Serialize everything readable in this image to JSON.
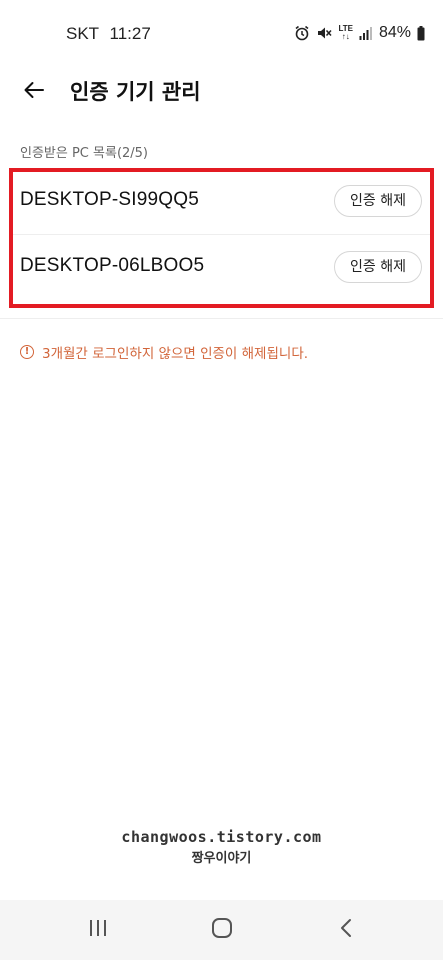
{
  "status_bar": {
    "carrier": "SKT",
    "time": "11:27",
    "battery": "84%",
    "lte_top": "LTE",
    "lte_bottom": "↑↓"
  },
  "header": {
    "title": "인증 기기 관리"
  },
  "section": {
    "label": "인증받은 PC 목록(2/5)"
  },
  "devices": [
    {
      "name": "DESKTOP-SI99QQ5",
      "action_label": "인증 해제"
    },
    {
      "name": "DESKTOP-06LBOO5",
      "action_label": "인증 해제"
    }
  ],
  "notice": {
    "icon_glyph": "!",
    "text": "3개월간 로그인하지 않으면 인증이 해제됩니다."
  },
  "watermark": {
    "url": "changwoos.tistory.com",
    "name": "짱우이야기"
  },
  "colors": {
    "highlight": "#e31b23",
    "notice": "#d2653a",
    "nav_bg": "#f5f5f5"
  },
  "icons": {
    "back": "arrow-left-icon",
    "alarm": "alarm-icon",
    "mute": "mute-icon",
    "signal": "signal-icon",
    "battery": "battery-icon",
    "notice": "alert-circle-icon",
    "recent_apps": "recent-apps-icon",
    "home": "home-icon",
    "nav_back": "chevron-left-icon"
  }
}
